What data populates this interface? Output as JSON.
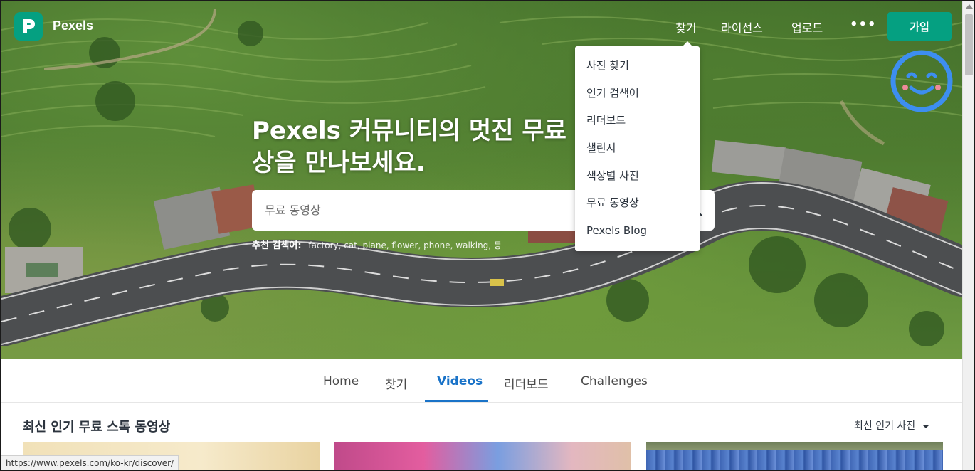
{
  "nav": {
    "logo_text": "Pexels",
    "links": [
      "찾기",
      "라이선스",
      "업로드"
    ],
    "more_label": "•••",
    "join_label": "가입"
  },
  "hero": {
    "title_line1": "Pexels 커뮤니티의 멋진 무료",
    "title_line2": "상을 만나보세요.",
    "search_placeholder": "무료 동영상",
    "suggest_label": "추천 검색어:",
    "suggest_items": "factory, cat, plane, flower, phone, walking, 등"
  },
  "dropdown": {
    "items": [
      "사진 찾기",
      "인기 검색어",
      "리더보드",
      "챌린지",
      "색상별 사진",
      "무료 동영상",
      "Pexels Blog"
    ]
  },
  "tabs": {
    "items": [
      "Home",
      "찾기",
      "Videos",
      "리더보드",
      "Challenges"
    ],
    "active": "Videos"
  },
  "section": {
    "title": "최신 인기 무료 스톡 동영상",
    "sort_label": "최신 인기 사진"
  },
  "status_url": "https://www.pexels.com/ko-kr/discover/",
  "colors": {
    "brand": "#05a081",
    "active_tab": "#1a73c8",
    "smiley": "#3d8ef0"
  },
  "icons": {
    "logo": "pexels-logo-icon",
    "search": "search-icon",
    "smiley": "smiley-face-icon",
    "sort": "caret-down-icon"
  }
}
